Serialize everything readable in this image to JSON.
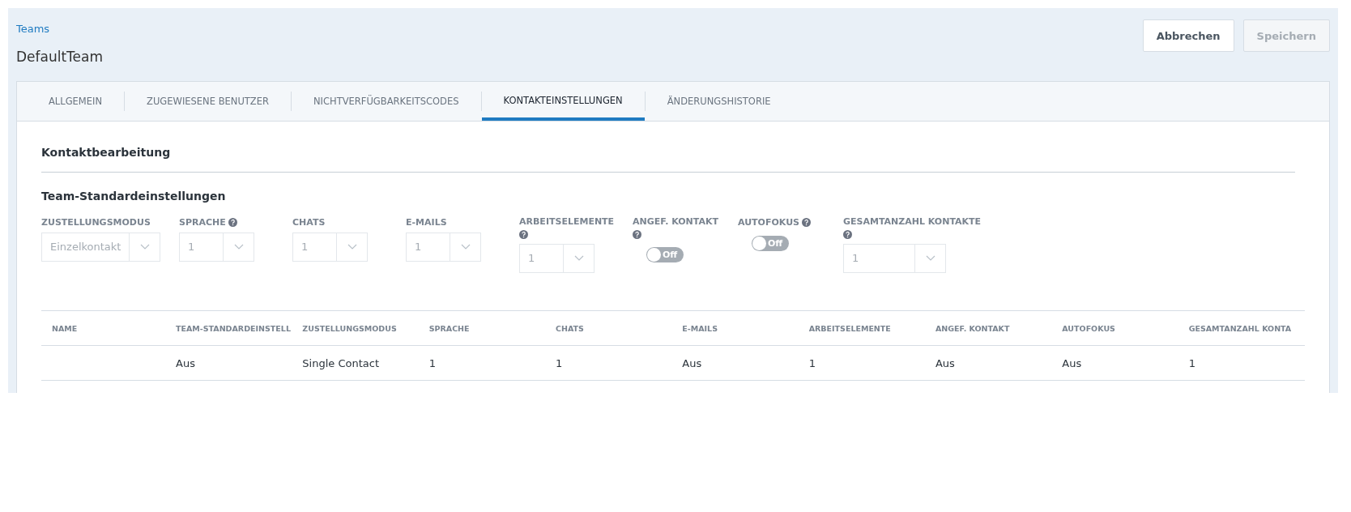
{
  "breadcrumb": "Teams",
  "title": "DefaultTeam",
  "buttons": [
    {
      "label": "Abbrechen",
      "disabled": false
    },
    {
      "label": "Speichern",
      "disabled": true
    }
  ],
  "tabs": [
    {
      "label": "ALLGEMEIN",
      "selected": false
    },
    {
      "label": "ZUGEWIESENE BENUTZER",
      "selected": false
    },
    {
      "label": "NICHTVERFÜGBARKEITSCODES",
      "selected": false
    },
    {
      "label": "KONTAKTEINSTELLUNGEN",
      "selected": true
    },
    {
      "label": "ÄNDERUNGSHISTORIE",
      "selected": false
    }
  ],
  "section_title": "Kontaktbearbeitung",
  "subsection_title": "Team-Standardeinstellungen",
  "fields": [
    {
      "kind": "select",
      "label": "ZUSTELLUNGSMODUS",
      "help": false,
      "value": "Einzelkontakt"
    },
    {
      "kind": "select",
      "label": "SPRACHE",
      "help": true,
      "value": "1"
    },
    {
      "kind": "select",
      "label": "CHATS",
      "help": false,
      "value": "1"
    },
    {
      "kind": "select",
      "label": "E-MAILS",
      "help": false,
      "value": "1"
    },
    {
      "kind": "select",
      "label": "ARBEITSELEMENTE",
      "help": true,
      "value": "1"
    },
    {
      "kind": "toggle",
      "label": "ANGEF. KONTAKT",
      "help": true,
      "on": false,
      "value": "Off"
    },
    {
      "kind": "toggle",
      "label": "AUTOFOKUS",
      "help": true,
      "on": false,
      "value": "Off"
    },
    {
      "kind": "select",
      "label": "GESAMTANZAHL KONTAKTE",
      "help": true,
      "value": "1"
    }
  ],
  "table": {
    "columns": [
      "NAME",
      "TEAM-STANDARDEINSTELL",
      "ZUSTELLUNGSMODUS",
      "SPRACHE",
      "CHATS",
      "E-MAILS",
      "ARBEITSELEMENTE",
      "ANGEF. KONTAKT",
      "AUTOFOKUS",
      "GESAMTANZAHL KONTA"
    ],
    "rows": [
      [
        "",
        "Aus",
        "Single Contact",
        "1",
        "1",
        "Aus",
        "1",
        "Aus",
        "Aus",
        "1"
      ]
    ]
  }
}
